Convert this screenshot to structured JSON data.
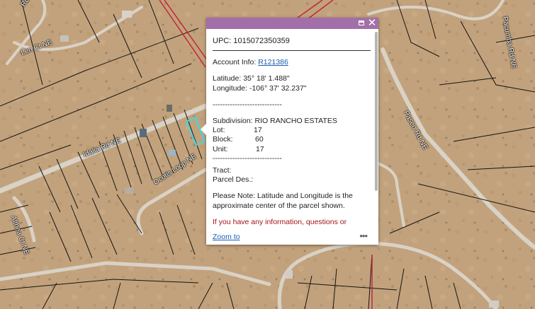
{
  "map": {
    "road_labels": [
      "Len Ct NE",
      "Rd NE",
      "Idalia Rd NE",
      "Ocotis Loop NE",
      "Althea Ct NE",
      "Paseo Rd NE",
      "Pacumba Rd NE"
    ],
    "colors": {
      "terrain": "#c0a07a",
      "road": "#d9d2c6",
      "parcel_line": "#141414",
      "selected_parcel": "#3fd9e6",
      "boundary_red": "#c0283a"
    }
  },
  "popup": {
    "header_color": "#a36fa8",
    "maximize_icon": "maximize-icon",
    "close_icon": "close-icon",
    "close_glyph": "✕",
    "title": "UPC: 1015072350359",
    "account_label": "Account Info: ",
    "account_link": "R121386",
    "latitude": "Latitude: 35° 18' 1.488\"",
    "longitude": "Longitude: -106° 37' 32.237\"",
    "separator": "----------------------------",
    "subdivision": "Subdivision: RIO RANCHO ESTATES",
    "lot_label": "Lot:",
    "lot_value": "17",
    "block_label": "Block:",
    "block_value": "60",
    "unit_label": "Unit:",
    "unit_value": "17",
    "tract_label": "Tract:",
    "parcel_des_label": "Parcel Des.:",
    "note": "Please Note: Latitude and Longitude is the approximate center of the parcel shown.",
    "info_text": "If you have any information, questions or",
    "zoom_label": "Zoom to",
    "more_label": "•••"
  }
}
